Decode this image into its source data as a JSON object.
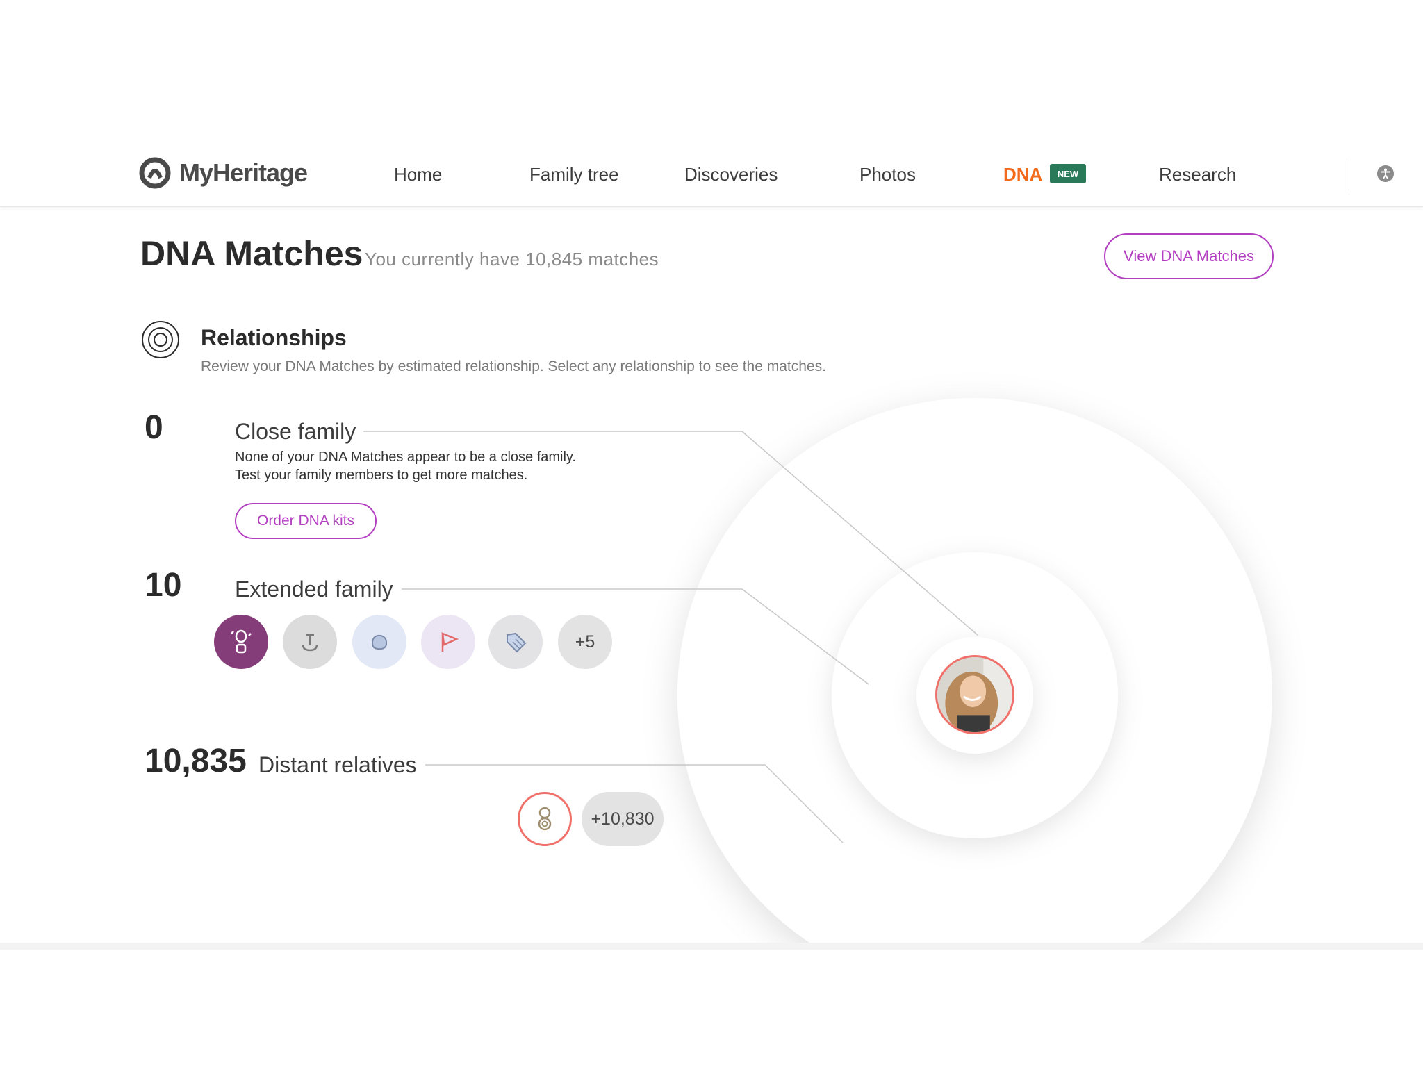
{
  "brand": {
    "name": "MyHeritage"
  },
  "nav": {
    "home": "Home",
    "family_tree": "Family tree",
    "discoveries": "Discoveries",
    "photos": "Photos",
    "dna": "DNA",
    "dna_badge": "NEW",
    "research": "Research"
  },
  "page": {
    "title": "DNA Matches",
    "subtitle": "You currently have 10,845 matches",
    "view_button": "View DNA Matches"
  },
  "relationships": {
    "title": "Relationships",
    "description": "Review your DNA Matches by estimated relationship. Select any relationship to see the matches."
  },
  "groups": {
    "close": {
      "count": "0",
      "label": "Close family",
      "line1": "None of your DNA Matches appear to be a close family.",
      "line2": "Test your family members to get more matches.",
      "button": "Order DNA kits"
    },
    "extended": {
      "count": "10",
      "label": "Extended family",
      "more": "+5"
    },
    "distant": {
      "count": "10,835",
      "label": "Distant relatives",
      "more": "+10,830"
    }
  },
  "colors": {
    "accent": "#b23fc0",
    "dna_nav": "#f26a1b",
    "badge": "#2a7a5a",
    "profile_ring": "#f0706a"
  }
}
